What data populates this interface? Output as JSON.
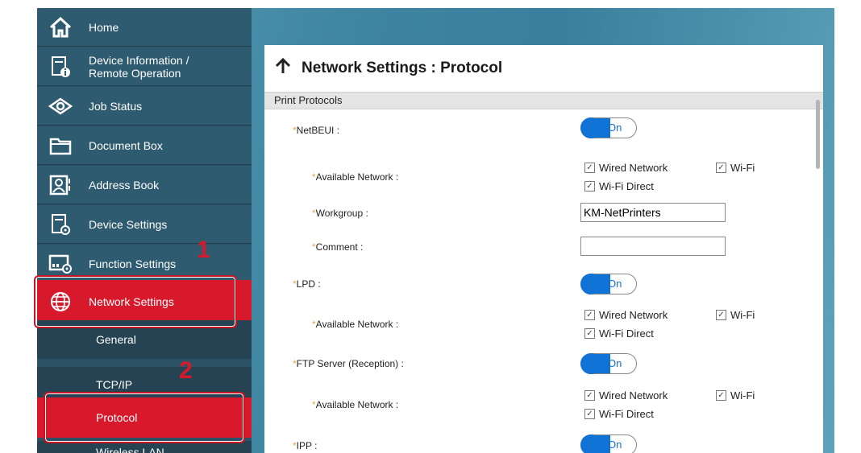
{
  "sidebar": {
    "items": [
      {
        "label": "Home",
        "icon": "home-icon"
      },
      {
        "label": "Device Information /\nRemote Operation",
        "icon": "device-info-icon"
      },
      {
        "label": "Job Status",
        "icon": "eye-icon"
      },
      {
        "label": "Document Box",
        "icon": "folder-icon"
      },
      {
        "label": "Address Book",
        "icon": "address-book-icon"
      },
      {
        "label": "Device Settings",
        "icon": "device-settings-icon"
      },
      {
        "label": "Function Settings",
        "icon": "function-settings-icon"
      },
      {
        "label": "Network Settings",
        "icon": "globe-icon"
      }
    ],
    "subitems": [
      "General",
      "TCP/IP",
      "Protocol",
      "Wireless LAN"
    ]
  },
  "callouts": [
    "1",
    "2"
  ],
  "panel": {
    "title": "Network Settings : Protocol",
    "section": "Print Protocols",
    "rows": {
      "netbeui": "NetBEUI :",
      "available_network": "Available Network :",
      "workgroup": "Workgroup :",
      "comment": "Comment :",
      "lpd": "LPD :",
      "ftp": "FTP Server (Reception) :",
      "ipp": "IPP :"
    },
    "toggle_on": "On",
    "star": "*",
    "checks": {
      "wired": "Wired Network",
      "wifi": "Wi-Fi",
      "wifi_direct": "Wi-Fi Direct",
      "mark": "✓"
    },
    "workgroup_value": "KM-NetPrinters",
    "comment_value": ""
  },
  "colors": {
    "accent_red": "#d7192b",
    "toggle_blue": "#1273d6",
    "sidebar": "#2f5b71"
  }
}
